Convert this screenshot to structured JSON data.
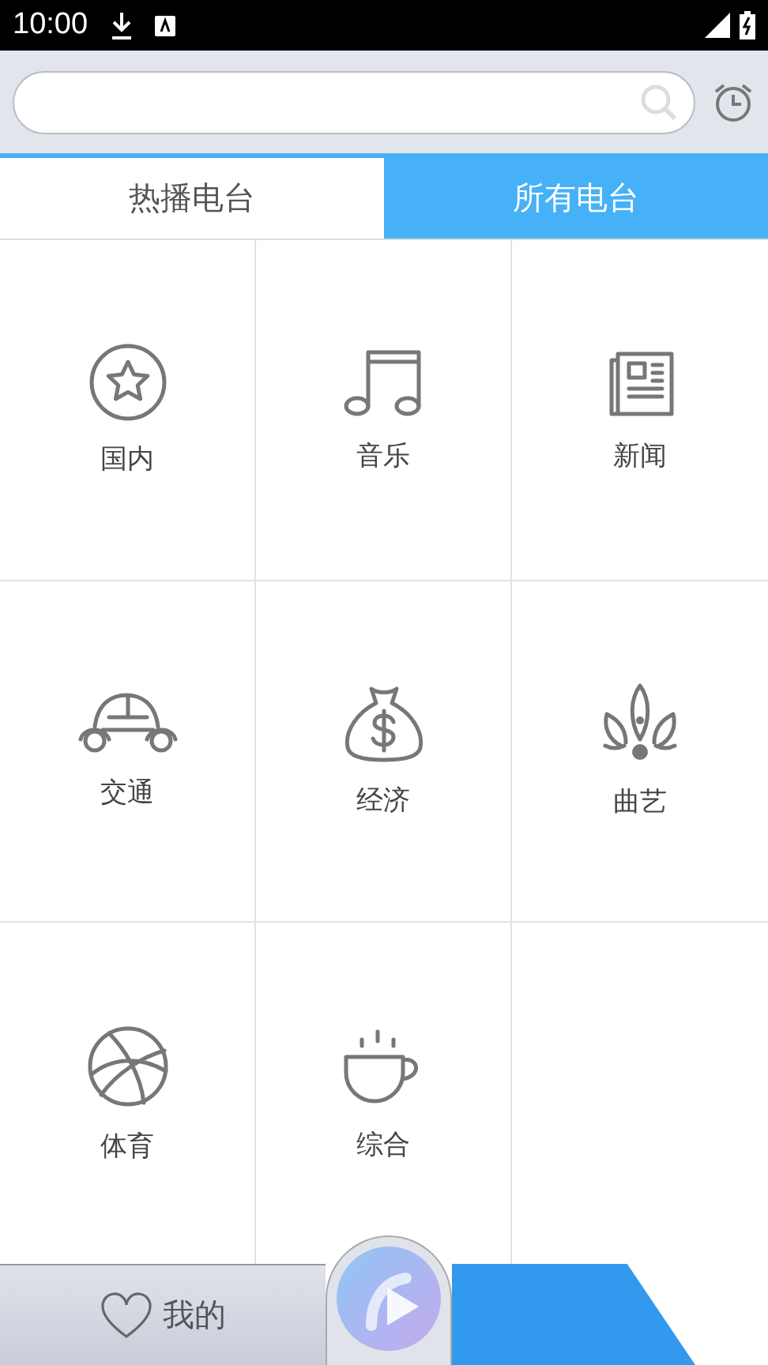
{
  "status_bar": {
    "time": "10:00"
  },
  "tabs": [
    {
      "label": "热播电台",
      "selected": false
    },
    {
      "label": "所有电台",
      "selected": true
    }
  ],
  "categories": [
    {
      "label": "国内",
      "kind": "star"
    },
    {
      "label": "音乐",
      "kind": "music"
    },
    {
      "label": "新闻",
      "kind": "news"
    },
    {
      "label": "交通",
      "kind": "car"
    },
    {
      "label": "经济",
      "kind": "money"
    },
    {
      "label": "曲艺",
      "kind": "opera"
    },
    {
      "label": "体育",
      "kind": "ball"
    },
    {
      "label": "综合",
      "kind": "cup"
    }
  ],
  "bottom_bar": {
    "favorites_label": "我的"
  }
}
